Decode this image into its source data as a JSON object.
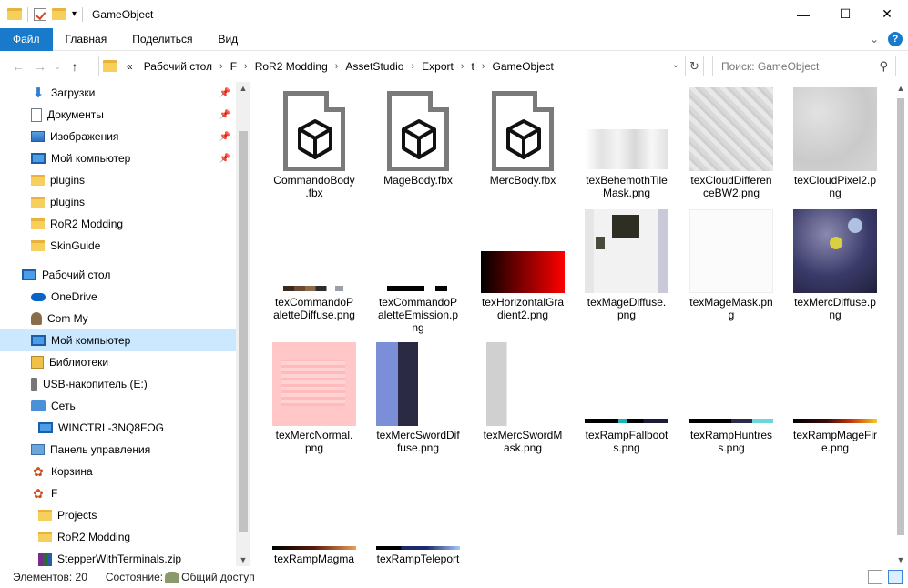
{
  "window": {
    "title": "GameObject"
  },
  "ribbon": {
    "tabs": [
      "Файл",
      "Главная",
      "Поделиться",
      "Вид"
    ]
  },
  "address": {
    "crumbs": [
      "«",
      "Рабочий стол",
      "F",
      "RoR2 Modding",
      "AssetStudio",
      "Export",
      "t",
      "GameObject"
    ]
  },
  "search": {
    "placeholder": "Поиск: GameObject"
  },
  "sidebar": {
    "items": [
      {
        "label": "Загрузки",
        "icon": "download-icon",
        "pinned": true
      },
      {
        "label": "Документы",
        "icon": "documents-icon",
        "pinned": true
      },
      {
        "label": "Изображения",
        "icon": "pictures-icon",
        "pinned": true
      },
      {
        "label": "Мой компьютер",
        "icon": "computer-icon",
        "pinned": true
      },
      {
        "label": "plugins",
        "icon": "folder-icon"
      },
      {
        "label": "plugins",
        "icon": "folder-icon"
      },
      {
        "label": "RoR2 Modding",
        "icon": "folder-icon"
      },
      {
        "label": "SkinGuide",
        "icon": "folder-icon"
      },
      {
        "label": "Рабочий стол",
        "icon": "desktop-icon"
      },
      {
        "label": "OneDrive",
        "icon": "onedrive-icon"
      },
      {
        "label": "Com My",
        "icon": "user-icon"
      },
      {
        "label": "Мой компьютер",
        "icon": "computer-icon",
        "selected": true
      },
      {
        "label": "Библиотеки",
        "icon": "libraries-icon"
      },
      {
        "label": "USB-накопитель (E:)",
        "icon": "usb-drive-icon"
      },
      {
        "label": "Сеть",
        "icon": "network-icon"
      },
      {
        "label": "WINCTRL-3NQ8FOG",
        "icon": "computer-icon"
      },
      {
        "label": "Панель управления",
        "icon": "control-panel-icon"
      },
      {
        "label": "Корзина",
        "icon": "recycle-bin-icon"
      },
      {
        "label": "F",
        "icon": "user-folder-icon"
      },
      {
        "label": "Projects",
        "icon": "folder-icon"
      },
      {
        "label": "RoR2 Modding",
        "icon": "folder-icon"
      },
      {
        "label": "StepperWithTerminals.zip",
        "icon": "archive-icon"
      }
    ]
  },
  "files": [
    {
      "name": "CommandoBody\n.fbx",
      "type": "fbx"
    },
    {
      "name": "MageBody.fbx",
      "type": "fbx"
    },
    {
      "name": "MercBody.fbx",
      "type": "fbx"
    },
    {
      "name": "texBehemothTile\nMask.png",
      "type": "img"
    },
    {
      "name": "texCloudDifferen\nceBW2.png",
      "type": "img"
    },
    {
      "name": "texCloudPixel2.p\nng",
      "type": "img"
    },
    {
      "name": "texCommandoP\naletteDiffuse.png",
      "type": "img"
    },
    {
      "name": "texCommandoP\naletteEmission.p\nng",
      "type": "img"
    },
    {
      "name": "texHorizontalGra\ndient2.png",
      "type": "img"
    },
    {
      "name": "texMageDiffuse.\npng",
      "type": "img"
    },
    {
      "name": "texMageMask.pn\ng",
      "type": "img"
    },
    {
      "name": "texMercDiffuse.p\nng",
      "type": "img"
    },
    {
      "name": "texMercNormal.\npng",
      "type": "img"
    },
    {
      "name": "texMercSwordDif\nfuse.png",
      "type": "img"
    },
    {
      "name": "texMercSwordM\nask.png",
      "type": "img"
    },
    {
      "name": "texRampFallboot\ns.png",
      "type": "img"
    },
    {
      "name": "texRampHuntres\ns.png",
      "type": "img"
    },
    {
      "name": "texRampMageFir\ne.png",
      "type": "img"
    },
    {
      "name": "texRampMagma",
      "type": "img"
    },
    {
      "name": "texRampTeleport",
      "type": "img"
    }
  ],
  "status": {
    "count": "Элементов: 20",
    "state_label": "Состояние:",
    "state_value": "Общий доступ"
  }
}
